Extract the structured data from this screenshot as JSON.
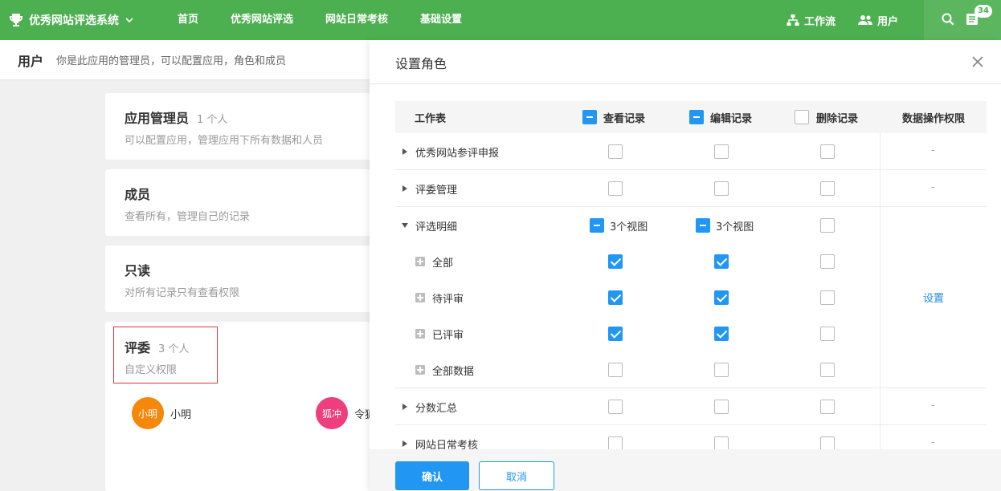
{
  "app": {
    "name": "优秀网站评选系统",
    "nav": [
      "首页",
      "优秀网站评选",
      "网站日常考核",
      "基础设置"
    ],
    "workflow": "工作流",
    "users": "用户",
    "notification_count": "34"
  },
  "page": {
    "title": "用户",
    "description": "你是此应用的管理员，可以配置应用，角色和成员"
  },
  "roles": [
    {
      "name": "应用管理员",
      "count": "1 个人",
      "desc": "可以配置应用，管理应用下所有数据和人员"
    },
    {
      "name": "成员",
      "count": "",
      "desc": "查看所有，管理自己的记录"
    },
    {
      "name": "只读",
      "count": "",
      "desc": "对所有记录只有查看权限"
    },
    {
      "name": "评委",
      "count": "3 个人",
      "desc": "自定义权限"
    }
  ],
  "members": [
    {
      "avatar_text": "小明",
      "name": "小明",
      "color": "#f5870a"
    },
    {
      "avatar_text": "狐冲",
      "name": "令狐",
      "color": "#ee3e7d"
    }
  ],
  "panel": {
    "title": "设置角色",
    "headers": {
      "sheet": "工作表",
      "view": "查看记录",
      "edit": "编辑记录",
      "delete": "删除记录",
      "data_perm": "数据操作权限"
    },
    "rows": [
      {
        "label": "优秀网站参评申报",
        "dash": "-"
      },
      {
        "label": "评委管理",
        "dash": "-"
      },
      {
        "label": "评选明细",
        "view_text": "3个视图",
        "edit_text": "3个视图"
      },
      {
        "label": "全部"
      },
      {
        "label": "待评审"
      },
      {
        "label": "已评审"
      },
      {
        "label": "全部数据"
      },
      {
        "label": "分数汇总",
        "dash": "-"
      },
      {
        "label": "网站日常考核",
        "dash": "-"
      }
    ],
    "set_link": "设置",
    "confirm": "确认",
    "cancel": "取消"
  },
  "colors": {
    "brand": "#4caf50",
    "accent": "#2196f3",
    "highlight": "#d9363e"
  }
}
